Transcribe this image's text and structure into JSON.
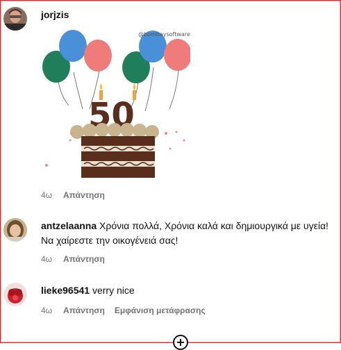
{
  "comments": [
    {
      "username": "jorjzis",
      "text": "",
      "time": "4ω",
      "reply": "Απάντηση"
    },
    {
      "username": "antzelaanna",
      "text": "Χρόνια πολλά, Χρόνια καλά και δημιουργικά με υγεία! Να χαίρεστε την οικογένειά σας!",
      "time": "4ω",
      "reply": "Απάντηση"
    },
    {
      "username": "lieke96541",
      "text": "verry nice",
      "time": "4ω",
      "reply": "Απάντηση",
      "translate": "Εμφάνιση μετάφρασης"
    }
  ],
  "sticker": {
    "watermark": "@bombaysoftwares",
    "number": "50"
  },
  "colors": {
    "balloon_green": "#1f7f5a",
    "balloon_blue": "#4a90d9",
    "balloon_pink": "#ef7b7b",
    "cake_brown": "#5a2e1c",
    "cake_beige": "#c8b48f"
  }
}
